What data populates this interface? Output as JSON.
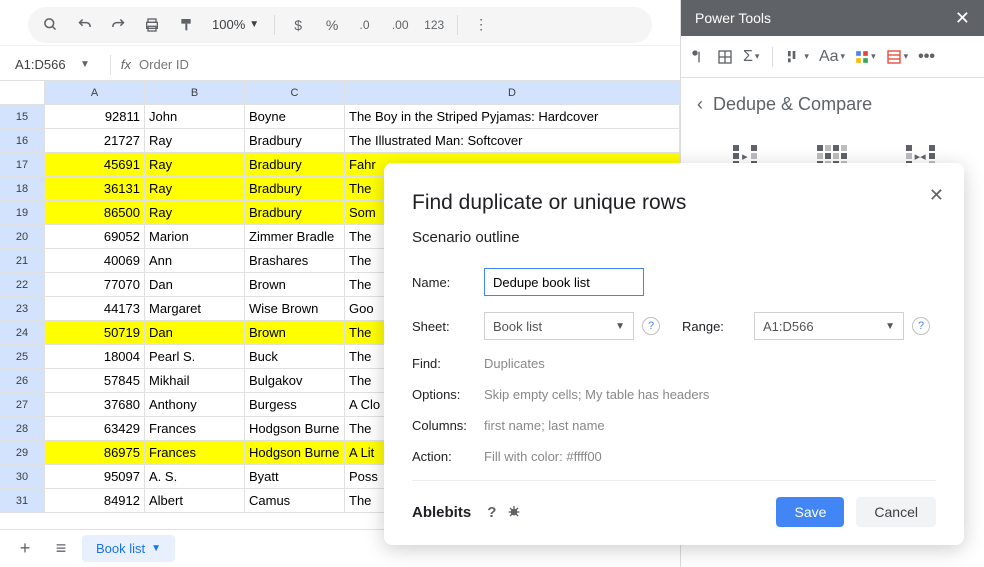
{
  "toolbar": {
    "zoom": "100%",
    "format_123": "123"
  },
  "formula_bar": {
    "cell_ref": "A1:D566",
    "fx": "fx",
    "value": "Order ID"
  },
  "columns": [
    "A",
    "B",
    "C",
    "D"
  ],
  "rows": [
    {
      "n": "15",
      "hl": false,
      "cells": [
        "92811",
        "John",
        "Boyne",
        "The Boy in the Striped Pyjamas: Hardcover"
      ]
    },
    {
      "n": "16",
      "hl": false,
      "cells": [
        "21727",
        "Ray",
        "Bradbury",
        "The Illustrated Man: Softcover"
      ]
    },
    {
      "n": "17",
      "hl": true,
      "cells": [
        "45691",
        "Ray",
        "Bradbury",
        "Fahr"
      ]
    },
    {
      "n": "18",
      "hl": true,
      "cells": [
        "36131",
        "Ray",
        "Bradbury",
        "The"
      ]
    },
    {
      "n": "19",
      "hl": true,
      "cells": [
        "86500",
        "Ray",
        "Bradbury",
        "Som"
      ]
    },
    {
      "n": "20",
      "hl": false,
      "cells": [
        "69052",
        "Marion",
        "Zimmer Bradle",
        "The"
      ]
    },
    {
      "n": "21",
      "hl": false,
      "cells": [
        "40069",
        "Ann",
        "Brashares",
        "The"
      ]
    },
    {
      "n": "22",
      "hl": false,
      "cells": [
        "77070",
        "Dan",
        "Brown",
        "The"
      ]
    },
    {
      "n": "23",
      "hl": false,
      "cells": [
        "44173",
        "Margaret",
        "Wise Brown",
        "Goo"
      ]
    },
    {
      "n": "24",
      "hl": true,
      "cells": [
        "50719",
        "Dan",
        "Brown",
        "The"
      ]
    },
    {
      "n": "25",
      "hl": false,
      "cells": [
        "18004",
        "Pearl S.",
        "Buck",
        "The"
      ]
    },
    {
      "n": "26",
      "hl": false,
      "cells": [
        "57845",
        "Mikhail",
        "Bulgakov",
        "The"
      ]
    },
    {
      "n": "27",
      "hl": false,
      "cells": [
        "37680",
        "Anthony",
        "Burgess",
        "A Clo"
      ]
    },
    {
      "n": "28",
      "hl": false,
      "cells": [
        "63429",
        "Frances",
        "Hodgson Burne",
        "The"
      ]
    },
    {
      "n": "29",
      "hl": true,
      "cells": [
        "86975",
        "Frances",
        "Hodgson Burne",
        "A Lit"
      ]
    },
    {
      "n": "30",
      "hl": false,
      "cells": [
        "95097",
        "A. S.",
        "Byatt",
        "Poss"
      ]
    },
    {
      "n": "31",
      "hl": false,
      "cells": [
        "84912",
        "Albert",
        "Camus",
        "The"
      ]
    }
  ],
  "sheet_tab": {
    "name": "Book list"
  },
  "sidebar": {
    "title": "Power Tools",
    "breadcrumb": "Dedupe & Compare"
  },
  "dialog": {
    "title": "Find duplicate or unique rows",
    "subtitle": "Scenario outline",
    "name_label": "Name:",
    "name_value": "Dedupe book list",
    "sheet_label": "Sheet:",
    "sheet_value": "Book list",
    "range_label": "Range:",
    "range_value": "A1:D566",
    "find_label": "Find:",
    "find_value": "Duplicates",
    "options_label": "Options:",
    "options_value": "Skip empty cells; My table has headers",
    "columns_label": "Columns:",
    "columns_value": "first name; last name",
    "action_label": "Action:",
    "action_value": "Fill with color: #ffff00",
    "brand": "Ablebits",
    "help": "?",
    "save": "Save",
    "cancel": "Cancel"
  }
}
